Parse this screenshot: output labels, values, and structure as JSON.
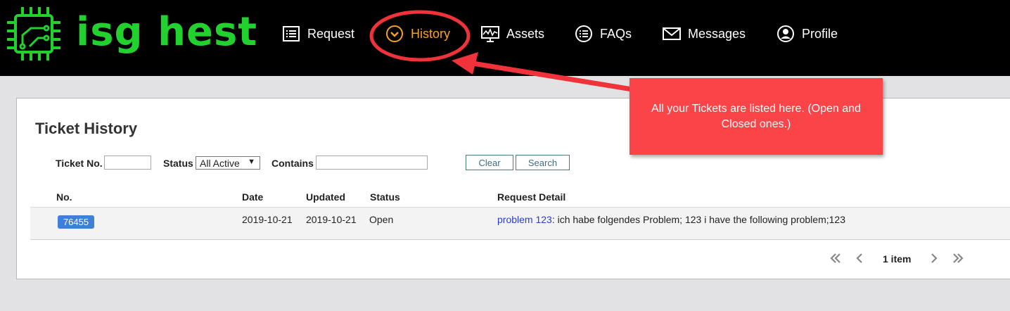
{
  "brand": {
    "name": "isg hest",
    "color": "#22d12e"
  },
  "nav": [
    {
      "label": "Request",
      "icon": "list-icon",
      "active": false
    },
    {
      "label": "History",
      "icon": "clock-chevron-icon",
      "active": true
    },
    {
      "label": "Assets",
      "icon": "monitor-chart-icon",
      "active": false
    },
    {
      "label": "FAQs",
      "icon": "list-circle-icon",
      "active": false
    },
    {
      "label": "Messages",
      "icon": "envelope-icon",
      "active": false
    },
    {
      "label": "Profile",
      "icon": "user-circle-icon",
      "active": false
    }
  ],
  "callout": {
    "text": "All your Tickets are listed here. (Open and Closed ones.)",
    "color": "#fb4448"
  },
  "panel": {
    "title": "Ticket History",
    "filters": {
      "ticket_no_label": "Ticket No.",
      "ticket_no_value": "",
      "status_label": "Status",
      "status_value": "All Active",
      "contains_label": "Contains",
      "contains_value": "",
      "clear_label": "Clear",
      "search_label": "Search"
    },
    "columns": {
      "no": "No.",
      "date": "Date",
      "updated": "Updated",
      "status": "Status",
      "detail": "Request Detail"
    },
    "rows": [
      {
        "no": "76455",
        "date": "2019-10-21",
        "updated": "2019-10-21",
        "status": "Open",
        "detail_link": "problem 123",
        "detail_text": ": ich habe folgendes Problem; 123 i have the following problem;123"
      }
    ],
    "pager": {
      "count_label": "1 item"
    }
  },
  "colors": {
    "accent": "#f7a02a",
    "badge": "#3f7fd8",
    "annotation": "#f0323a"
  }
}
